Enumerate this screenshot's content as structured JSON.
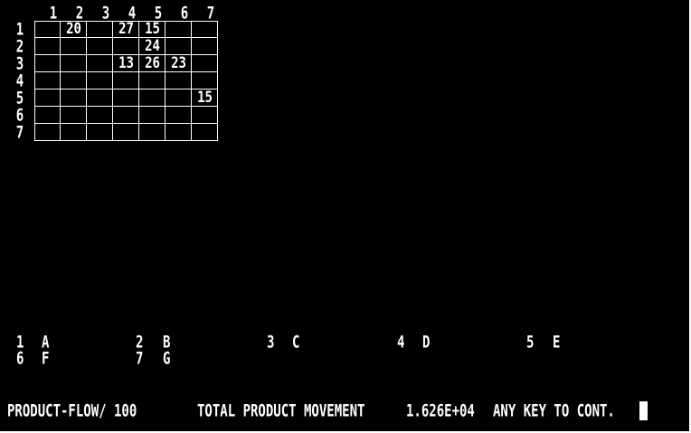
{
  "grid": {
    "column_numbers": [
      "1",
      "2",
      "3",
      "4",
      "5",
      "6",
      "7"
    ],
    "row_numbers": [
      "1",
      "2",
      "3",
      "4",
      "5",
      "6",
      "7"
    ],
    "cells": [
      {
        "row": 1,
        "col": 2,
        "value": "20"
      },
      {
        "row": 1,
        "col": 4,
        "value": "27"
      },
      {
        "row": 1,
        "col": 5,
        "value": "15"
      },
      {
        "row": 2,
        "col": 5,
        "value": "24"
      },
      {
        "row": 3,
        "col": 4,
        "value": "13"
      },
      {
        "row": 3,
        "col": 5,
        "value": "26"
      },
      {
        "row": 3,
        "col": 6,
        "value": "23"
      },
      {
        "row": 5,
        "col": 7,
        "value": "15"
      }
    ]
  },
  "legend": {
    "row1": [
      {
        "num": "1",
        "letter": "A"
      },
      {
        "num": "2",
        "letter": "B"
      },
      {
        "num": "3",
        "letter": "C"
      },
      {
        "num": "4",
        "letter": "D"
      },
      {
        "num": "5",
        "letter": "E"
      }
    ],
    "row2": [
      {
        "num": "6",
        "letter": "F"
      },
      {
        "num": "7",
        "letter": "G"
      }
    ]
  },
  "status": {
    "product_flow": "PRODUCT-FLOW/ 100",
    "total_label": "TOTAL PRODUCT MOVEMENT",
    "total_value": "1.626E+04",
    "prompt": "ANY KEY TO CONT."
  },
  "colors": {
    "background": "#000000",
    "foreground": "#ffffff"
  }
}
